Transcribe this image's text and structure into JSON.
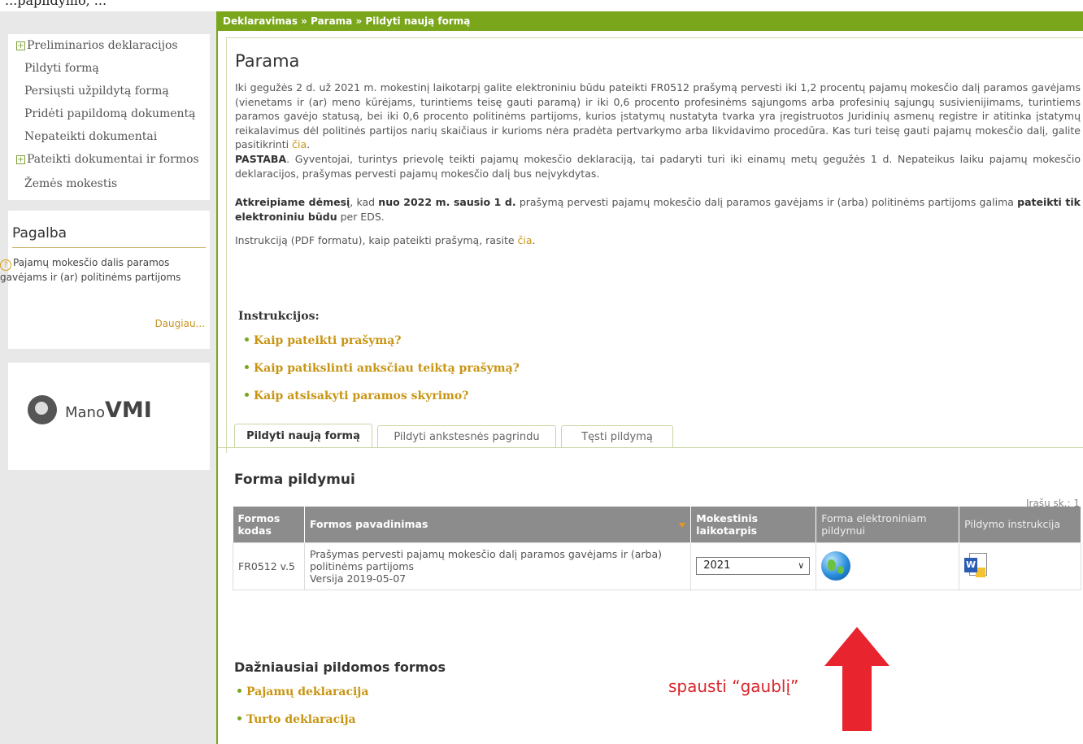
{
  "top_strip": {
    "text": "...papildymo, ..."
  },
  "sidebar": {
    "menu": [
      {
        "label": "Preliminarios deklaracijos",
        "group": true
      },
      {
        "label": "Pildyti formą",
        "group": false
      },
      {
        "label": "Persiųsti užpildytą formą",
        "group": false
      },
      {
        "label": "Pridėti papildomą dokumentą",
        "group": false
      },
      {
        "label": "Nepateikti dokumentai",
        "group": false
      },
      {
        "label": "Pateikti dokumentai ir formos",
        "group": true
      },
      {
        "label": "Žemės mokestis",
        "group": false
      }
    ],
    "help": {
      "title": "Pagalba",
      "text": "Pajamų mokesčio dalis paramos gavėjams ir (ar) politinėms partijoms",
      "more": "Daugiau..."
    },
    "logo": {
      "mano": "Mano",
      "vmi": "VMI"
    }
  },
  "breadcrumb": "Deklaravimas » Parama » Pildyti naują formą",
  "content": {
    "title": "Parama",
    "para1": "Iki gegužės 2 d. už 2021 m. mokestinį laikotarpį galite elektroniniu būdu pateikti FR0512 prašymą pervesti iki 1,2 procentų pajamų mokesčio dalį paramos gavėjams (vienetams ir (ar) meno kūrėjams, turintiems teisę gauti paramą) ir iki 0,6 procento profesinėms sąjungoms arba profesinių sąjungų susivienijimams, turintiems paramos gavėjo statusą, bei iki 0,6 procento politinėms partijoms, kurios įstatymų nustatyta tvarka yra įregistruotos Juridinių asmenų registre ir atitinka įstatymų reikalavimus dėl politinės partijos narių skaičiaus ir kurioms nėra pradėta pertvarkymo arba likvidavimo procedūra. Kas turi teisę gauti pajamų mokesčio dalį, galite pasitikrinti",
    "para1_link": "čia",
    "para2_bold": "PASTABA",
    "para2": ". Gyventojai, turintys prievolę teikti pajamų mokesčio deklaraciją, tai padaryti turi iki einamų metų gegužės 1 d. Nepateikus laiku pajamų mokesčio deklaracijos, prašymas pervesti pajamų mokesčio dalį bus neįvykdytas.",
    "para3_b1": "Atkreipiame dėmesį",
    "para3_t1": ", kad ",
    "para3_b2": "nuo 2022 m. sausio 1 d.",
    "para3_t2": " prašymą pervesti pajamų mokesčio dalį paramos gavėjams ir (arba) politinėms partijoms galima ",
    "para3_b3": "pateikti tik elektroniniu būdu",
    "para3_t3": " per EDS.",
    "para4": "Instrukciją (PDF formatu), kaip pateikti prašymą, rasite",
    "para4_link": "čia",
    "instructions_title": "Instrukcijos:",
    "instructions": [
      "Kaip pateikti prašymą?",
      "Kaip patikslinti anksčiau teiktą prašymą?",
      "Kaip atsisakyti paramos skyrimo?"
    ]
  },
  "tabs": [
    "Pildyti naują formą",
    "Pildyti ankstesnės pagrindu",
    "Tęsti pildymą"
  ],
  "form_section": {
    "title": "Forma pildymui",
    "record_count": "Įrašų sk.: 1",
    "headers": [
      "Formos kodas",
      "Formos pavadinimas",
      "Mokestinis laikotarpis",
      "Forma elektroniniam pildymui",
      "Pildymo instrukcija"
    ],
    "row": {
      "code": "FR0512 v.5",
      "name": "Prašymas pervesti pajamų mokesčio dalį paramos gavėjams ir (arba) politinėms partijoms",
      "version": "Versija 2019-05-07",
      "period": "2021"
    }
  },
  "frequent": {
    "title": "Dažniausiai pildomos formos",
    "items": [
      "Pajamų deklaracija",
      "Turto deklaracija"
    ]
  },
  "annotation": "spausti “gaublį”",
  "colors": {
    "accent": "#7aa61c",
    "link": "#c89512",
    "annotation": "#d9262b"
  }
}
